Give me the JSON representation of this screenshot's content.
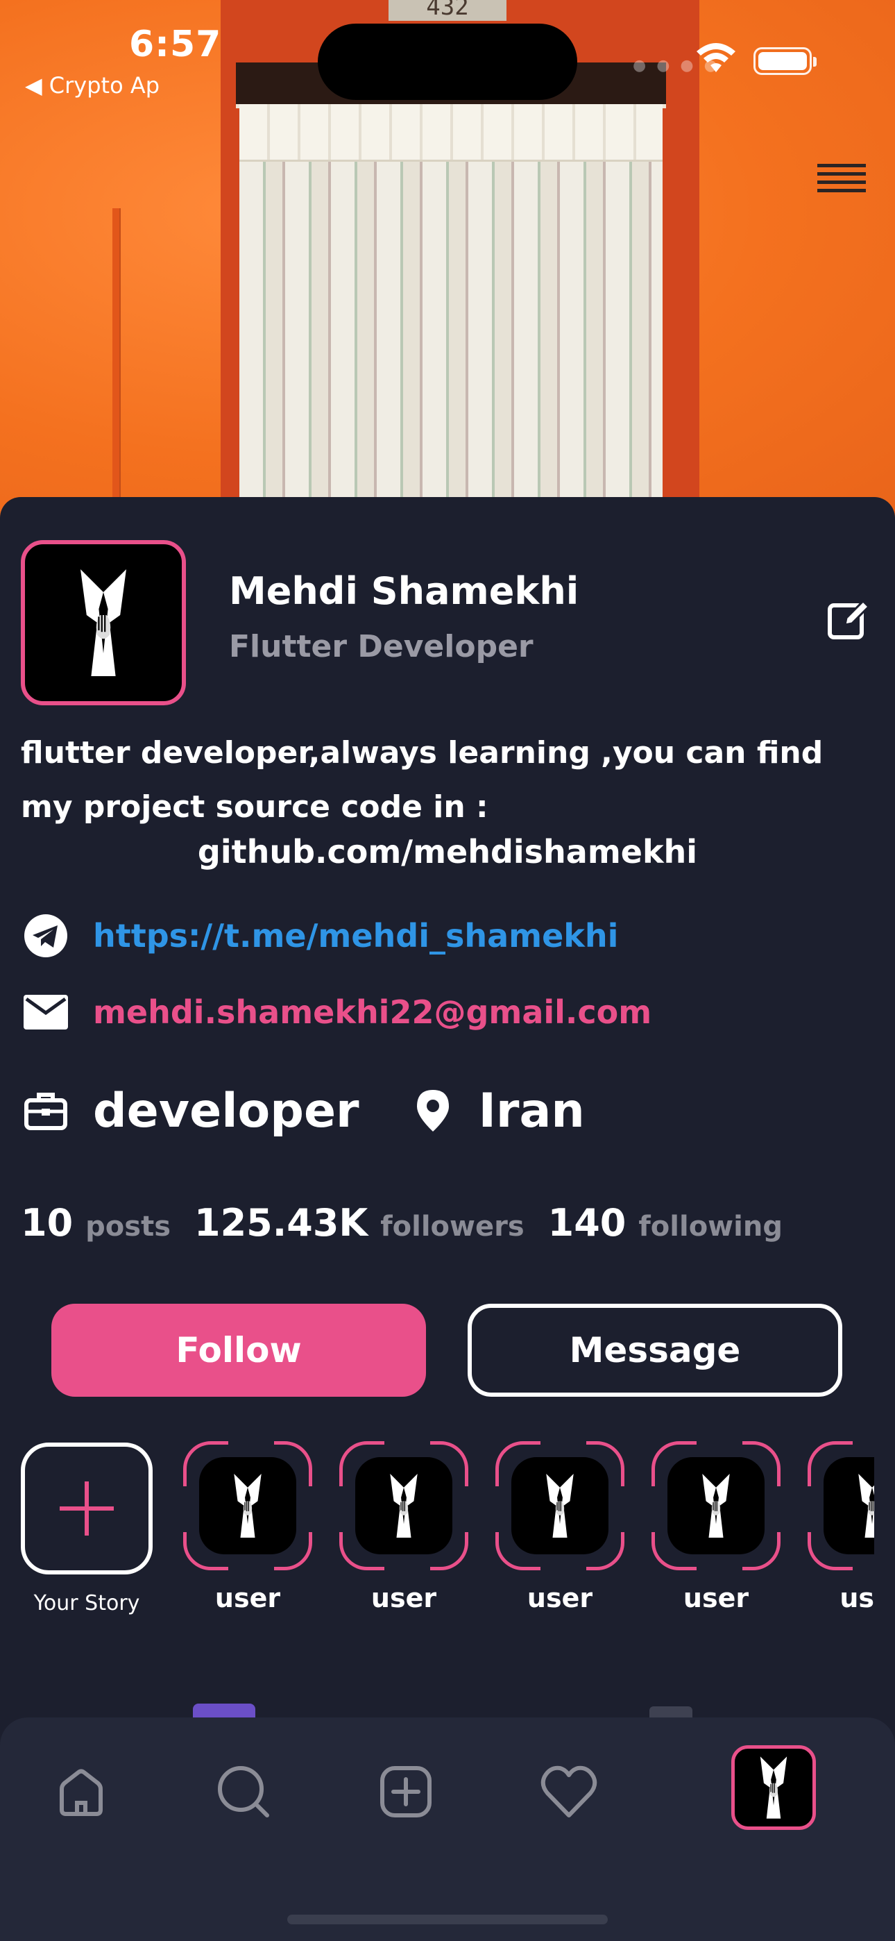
{
  "status_bar": {
    "time": "6:57",
    "back_label": "◀ Crypto Ap"
  },
  "header": {
    "door_number": "432",
    "menu_icon": "menu-icon"
  },
  "profile": {
    "name": "Mehdi Shamekhi",
    "role": "Flutter Developer",
    "bio": "flutter developer,always learning ,you can find my project source code in :",
    "bio_link": "github.com/mehdishamekhi",
    "telegram": "https://t.me/mehdi_shamekhi",
    "email": "mehdi.shamekhi22@gmail.com",
    "job": "developer",
    "location": "Iran"
  },
  "stats": {
    "posts_count": "10",
    "posts_label": "posts",
    "followers_count": "125.43K",
    "followers_label": "followers",
    "following_count": "140",
    "following_label": "following"
  },
  "actions": {
    "follow_label": "Follow",
    "message_label": "Message"
  },
  "stories": {
    "your_story_label": "Your Story",
    "items": [
      {
        "label": "user"
      },
      {
        "label": "user"
      },
      {
        "label": "user"
      },
      {
        "label": "user"
      },
      {
        "label": "us"
      }
    ]
  },
  "nav": {
    "items": [
      "home-icon",
      "search-icon",
      "add-post-icon",
      "heart-icon",
      "profile-avatar"
    ]
  },
  "colors": {
    "accent": "#e9508a",
    "background": "#1c1f2e",
    "link": "#2f95e6",
    "nav_background": "#242839"
  }
}
